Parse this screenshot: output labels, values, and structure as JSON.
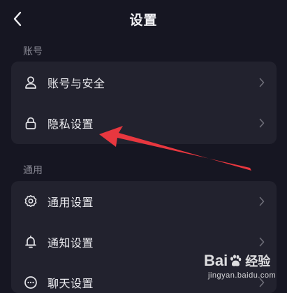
{
  "header": {
    "title": "设置",
    "back_icon": "chevron-left-icon"
  },
  "sections": [
    {
      "title": "账号",
      "items": [
        {
          "label": "账号与安全",
          "icon": "user-icon"
        },
        {
          "label": "隐私设置",
          "icon": "lock-icon"
        }
      ]
    },
    {
      "title": "通用",
      "items": [
        {
          "label": "通用设置",
          "icon": "gear-icon"
        },
        {
          "label": "通知设置",
          "icon": "bell-icon"
        },
        {
          "label": "聊天设置",
          "icon": "chat-icon"
        }
      ]
    }
  ],
  "annotation": {
    "color": "#e8373f",
    "target": "隐私设置"
  },
  "watermark": {
    "brand_before": "Bai",
    "brand_after": "经验",
    "domain": "jingyan.baidu.com"
  },
  "colors": {
    "background": "#161622",
    "card": "#22222e",
    "text": "#ececf0",
    "muted": "#8a8a95"
  }
}
